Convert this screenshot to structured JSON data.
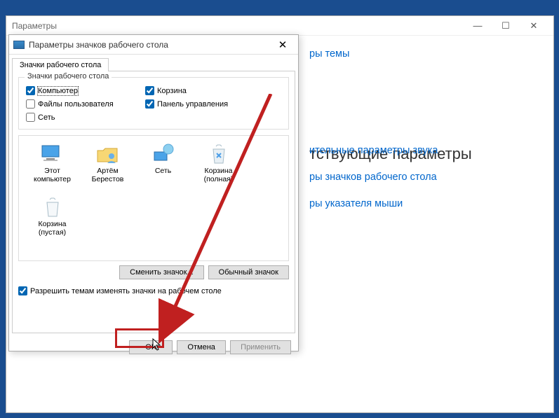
{
  "settings_window": {
    "title": "Параметры",
    "heading_fragment_1": "ры темы",
    "heading_main": "тствующие параметры",
    "links": [
      "ительные параметры звука",
      "ры значков рабочего стола",
      "ры указателя мыши"
    ]
  },
  "dialog": {
    "title": "Параметры значков рабочего стола",
    "tab_label": "Значки рабочего стола",
    "group_title": "Значки рабочего стола",
    "checkboxes": {
      "computer": {
        "label": "Компьютер",
        "checked": true
      },
      "recycle": {
        "label": "Корзина",
        "checked": true
      },
      "userfiles": {
        "label": "Файлы пользователя",
        "checked": false
      },
      "cpanel": {
        "label": "Панель управления",
        "checked": true
      },
      "network": {
        "label": "Сеть",
        "checked": false
      }
    },
    "icons": [
      {
        "name": "pc",
        "label": "Этот компьютер"
      },
      {
        "name": "user",
        "label": "Артём Берестов"
      },
      {
        "name": "net",
        "label": "Сеть"
      },
      {
        "name": "bin-full",
        "label": "Корзина (полная)"
      },
      {
        "name": "bin-empty",
        "label": "Корзина (пустая)"
      }
    ],
    "change_icon_btn": "Сменить значок...",
    "default_icon_btn": "Обычный значок",
    "allow_themes_label": "Разрешить темам изменять значки на рабочем столе",
    "allow_themes_checked": true,
    "ok_btn": "OK",
    "cancel_btn": "Отмена",
    "apply_btn": "Применить"
  }
}
